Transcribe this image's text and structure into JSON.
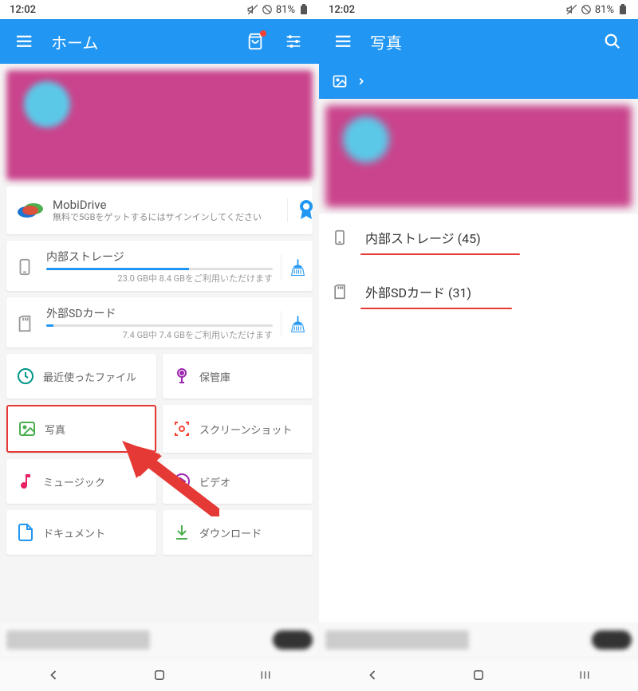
{
  "status": {
    "time": "12:02",
    "battery": "81%"
  },
  "left": {
    "title": "ホーム",
    "mobidrive": {
      "title": "MobiDrive",
      "sub": "無料で5GBをゲットするにはサインインしてください"
    },
    "internal": {
      "title": "内部ストレージ",
      "detail": "23.0 GB中 8.4 GBをご利用いただけます",
      "fill": 63
    },
    "external": {
      "title": "外部SDカード",
      "detail": "7.4 GB中 7.4 GBをご利用いただけます",
      "fill": 3
    },
    "grid": {
      "recent": "最近使ったファイル",
      "vault": "保管庫",
      "photos": "写真",
      "screenshot": "スクリーンショット",
      "music": "ミュージック",
      "video": "ビデオ",
      "document": "ドキュメント",
      "download": "ダウンロード"
    }
  },
  "right": {
    "title": "写真",
    "internal": "内部ストレージ (45)",
    "external": "外部SDカード (31)"
  },
  "colors": {
    "primary": "#2196F3",
    "accent_red": "#e53935",
    "promo": "#c9448c"
  }
}
